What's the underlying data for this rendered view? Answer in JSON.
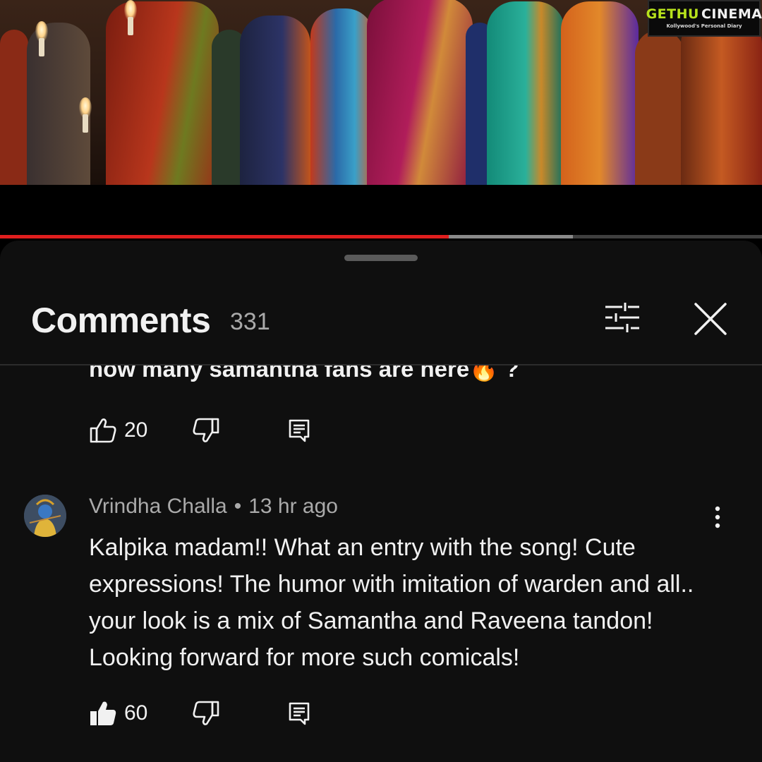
{
  "brand": {
    "name_part1": "GETHU",
    "name_part2": "CINEMA",
    "tagline": "Kollywood's Personal Diary",
    "accent_color": "#b7e21c"
  },
  "video": {
    "description_icon": "video-frame",
    "progress_fraction": 0.589,
    "buffer_fraction": 0.752,
    "progress_color": "#e01e1e"
  },
  "comments_panel": {
    "title": "Comments",
    "count": "331",
    "filter_icon": "sliders-icon",
    "close_icon": "close-icon"
  },
  "comments": [
    {
      "text": "how many samantha fans are here🔥 ?",
      "likes": "20",
      "like_icon": "thumb-up-outline-icon",
      "dislike_icon": "thumb-down-outline-icon",
      "reply_icon": "reply-icon"
    },
    {
      "author": "Vrindha Challa",
      "separator": "•",
      "time": "13 hr ago",
      "text": "Kalpika madam!! What an entry with the song! Cute expressions! The humor with imitation of warden and all.. your look is a mix of Samantha and Raveena tandon! Looking forward for more such comicals!",
      "likes": "60",
      "like_icon": "thumb-up-filled-icon",
      "dislike_icon": "thumb-down-outline-icon",
      "reply_icon": "reply-icon",
      "menu_icon": "more-vert-icon"
    }
  ]
}
